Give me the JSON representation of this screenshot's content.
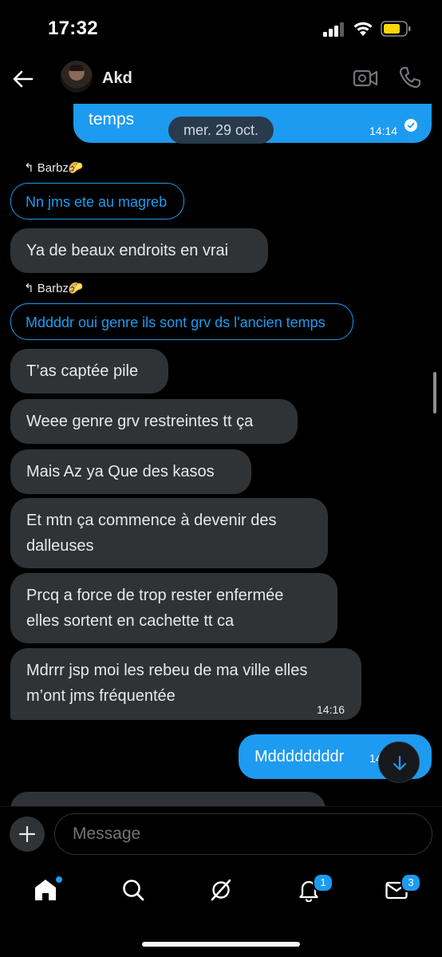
{
  "status": {
    "time": "17:32"
  },
  "header": {
    "contact_name": "Akd"
  },
  "messages": {
    "top_sent_text": "temps",
    "top_sent_time": "14:14",
    "date_separator": "mer. 29 oct.",
    "reply1_label": "Barbz🌮",
    "reply1_quote": "Nn jms ete au magreb",
    "msg1": "Ya de beaux endroits en vrai",
    "reply2_label": "Barbz🌮",
    "reply2_quote": "Mddddr oui genre ils sont grv ds l'ancien temps",
    "msg2": "T’as captée pile",
    "msg3": "Weee genre grv restreintes tt ça",
    "msg4": "Mais Az ya Que des kasos",
    "msg5_line1": "Et mtn ça commence à devenir des",
    "msg5_line2": "dalleuses",
    "msg6_line1": "Prcq a force de trop rester enfermée",
    "msg6_line2": "elles sortent en cachette tt ca",
    "msg7_line1": "Mdrrr jsp moi les rebeu de ma ville elles",
    "msg7_line2": "m’ont jms fréquentée",
    "msg7_time": "14:16",
    "sent2": "Mddddddddr",
    "sent2_time": "14"
  },
  "composer": {
    "placeholder": "Message"
  },
  "tabbar": {
    "notifications_badge": "1",
    "messages_badge": "3"
  },
  "colors": {
    "accent": "#1d9bf0",
    "bubble_received": "#2f3336",
    "background": "#000000"
  },
  "icons": [
    "back-arrow-icon",
    "video-icon",
    "phone-icon",
    "scroll-down-icon",
    "plus-icon",
    "home-icon",
    "search-icon",
    "grok-icon",
    "bell-icon",
    "mail-icon"
  ]
}
